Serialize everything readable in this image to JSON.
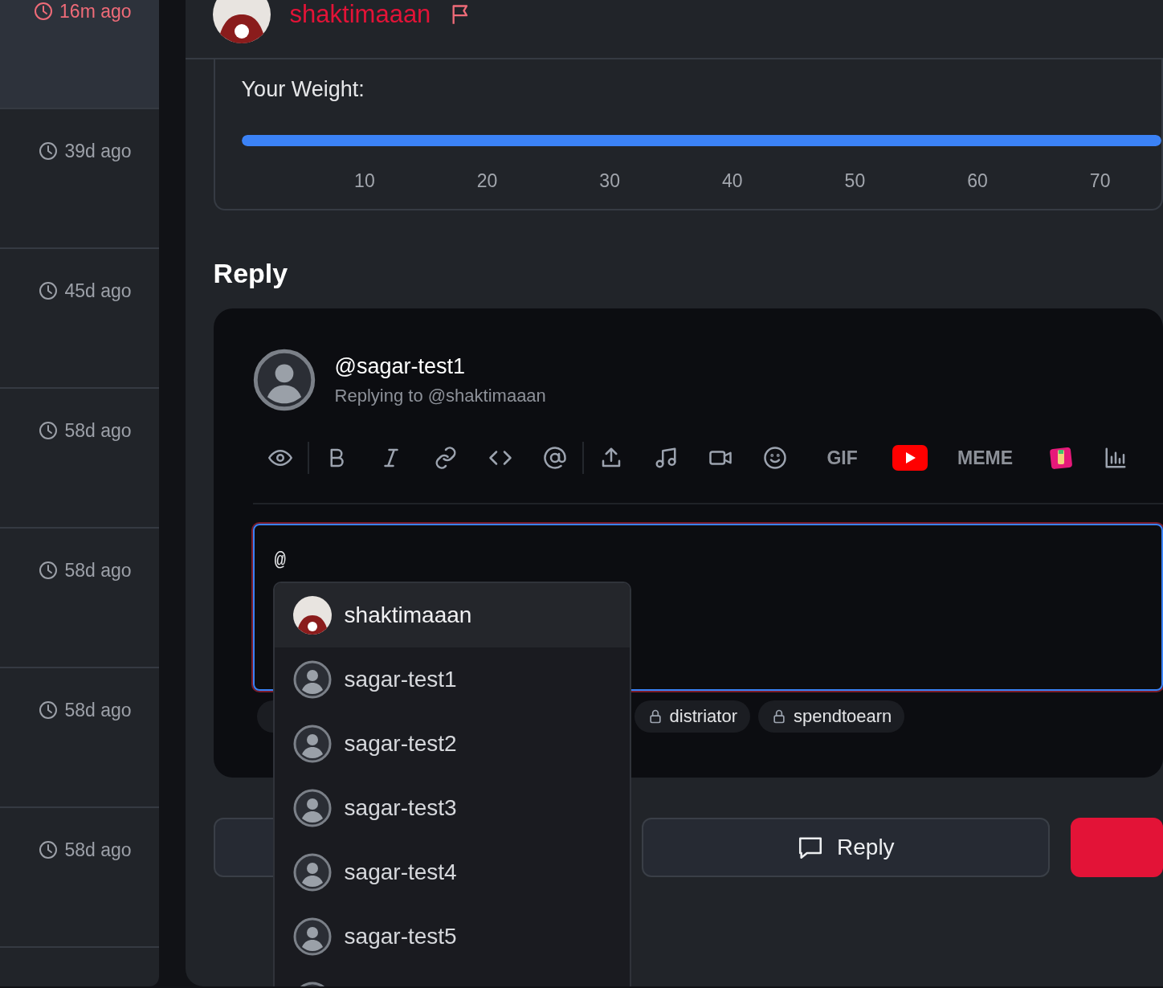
{
  "sidebar": {
    "items": [
      {
        "time": "16m ago",
        "selected": true
      },
      {
        "time": "39d ago",
        "selected": false
      },
      {
        "time": "45d ago",
        "selected": false
      },
      {
        "time": "58d ago",
        "selected": false
      },
      {
        "time": "58d ago",
        "selected": false
      },
      {
        "time": "58d ago",
        "selected": false
      },
      {
        "time": "58d ago",
        "selected": false
      }
    ]
  },
  "post": {
    "author": "shaktimaaan"
  },
  "poll": {
    "label": "Your Weight:",
    "slider": {
      "level": 1,
      "ticks": [
        "10",
        "20",
        "30",
        "40",
        "50",
        "60",
        "70"
      ]
    }
  },
  "reply": {
    "heading": "Reply",
    "user": "@sagar-test1",
    "replying_to": "Replying to @shaktimaaan",
    "toolbar_texts": [
      "GIF",
      "MEME"
    ],
    "editor": {
      "value": "@"
    },
    "communities": [
      {
        "name": "distriator"
      },
      {
        "name": "spendtoearn"
      }
    ],
    "mentions": [
      {
        "name": "shaktimaaan",
        "kind": "photo",
        "selected": true
      },
      {
        "name": "sagar-test1",
        "kind": "default",
        "selected": false
      },
      {
        "name": "sagar-test2",
        "kind": "default",
        "selected": false
      },
      {
        "name": "sagar-test3",
        "kind": "default",
        "selected": false
      },
      {
        "name": "sagar-test4",
        "kind": "default",
        "selected": false
      },
      {
        "name": "sagar-test5",
        "kind": "default",
        "selected": false
      }
    ],
    "reply_button": "Reply"
  }
}
